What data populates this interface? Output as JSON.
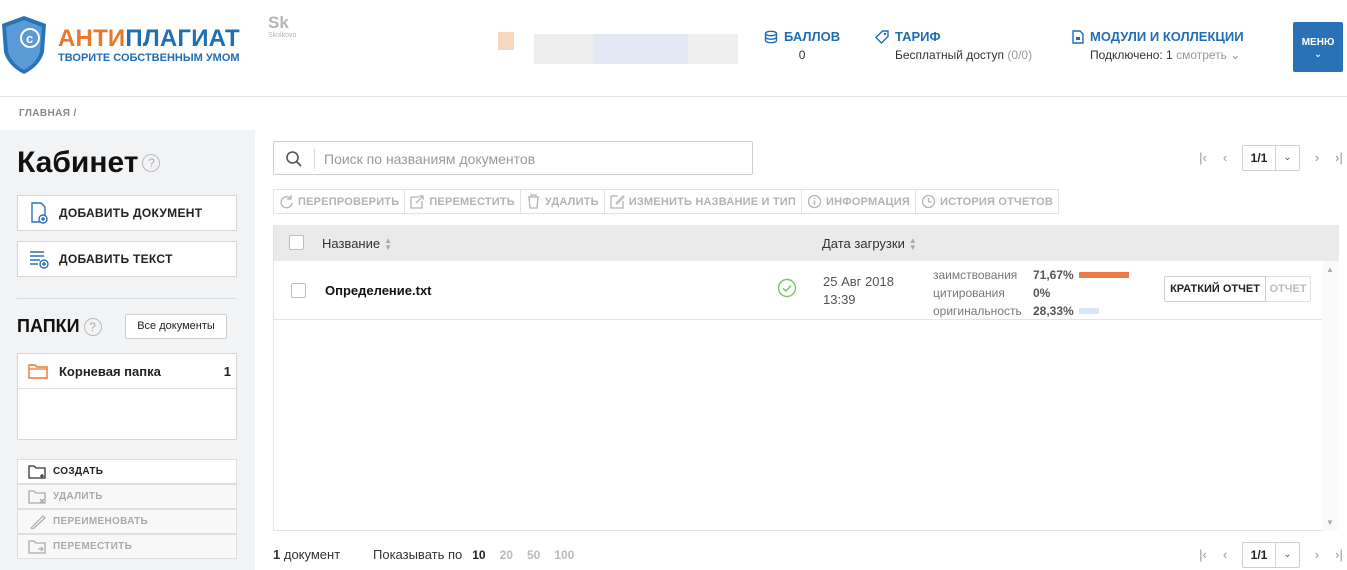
{
  "header": {
    "logo_part1": "АНТИ",
    "logo_part2": "ПЛАГИАТ",
    "logo_tagline": "ТВОРИТЕ СОБСТВЕННЫМ УМОМ",
    "partner_logo": "Sk",
    "partner_logo_small": "Skolkovo",
    "points": {
      "title": "БАЛЛОВ",
      "value": "0"
    },
    "tariff": {
      "title": "ТАРИФ",
      "value": "Бесплатный доступ",
      "value_extra": "(0/0)"
    },
    "modules": {
      "title": "МОДУЛИ И КОЛЛЕКЦИИ",
      "value": "Подключено: 1",
      "link": "смотреть"
    },
    "menu_label": "МЕНЮ"
  },
  "breadcrumb": "ГЛАВНАЯ /",
  "sidebar": {
    "title": "Кабинет",
    "add_document": "ДОБАВИТЬ ДОКУМЕНТ",
    "add_text": "ДОБАВИТЬ ТЕКСТ",
    "folders_title": "ПАПКИ",
    "all_documents": "Все документы",
    "folders": [
      {
        "name": "Корневая папка",
        "count": "1"
      }
    ],
    "folder_actions": {
      "create": "СОЗДАТЬ",
      "delete": "УДАЛИТЬ",
      "rename": "ПЕРЕИМЕНОВАТЬ",
      "move": "ПЕРЕМЕСТИТЬ"
    }
  },
  "search": {
    "placeholder": "Поиск по названиям документов"
  },
  "pagination": {
    "current": "1/1"
  },
  "toolbar": {
    "recheck": "ПЕРЕПРОВЕРИТЬ",
    "move": "ПЕРЕМЕСТИТЬ",
    "delete": "УДАЛИТЬ",
    "rename": "ИЗМЕНИТЬ НАЗВАНИЕ И ТИП",
    "info": "ИНФОРМАЦИЯ",
    "history": "ИСТОРИЯ ОТЧЕТОВ"
  },
  "table": {
    "col_name": "Название",
    "col_date": "Дата загрузки",
    "rows": [
      {
        "name": "Определение.txt",
        "date": "25 Авг 2018",
        "time": "13:39",
        "borrowing_label": "заимствования",
        "borrowing": "71,67%",
        "citation_label": "цитирования",
        "citation": "0%",
        "originality_label": "оригинальность",
        "originality": "28,33%",
        "borrowing_fraction": 0.7167,
        "originality_fraction": 0.2833,
        "short_report": "КРАТКИЙ ОТЧЕТ",
        "report": "ОТЧЕТ"
      }
    ]
  },
  "footer": {
    "count_num": "1",
    "count_label": "документ",
    "show_label": "Показывать по",
    "page_sizes": [
      "10",
      "20",
      "50",
      "100"
    ]
  },
  "colors": {
    "brand_blue": "#1f6fb5",
    "brand_orange": "#e8792b",
    "borrowing_bar": "#ec7a4a",
    "originality_bar": "#d7e7f7",
    "ok_green": "#7cc36b"
  }
}
